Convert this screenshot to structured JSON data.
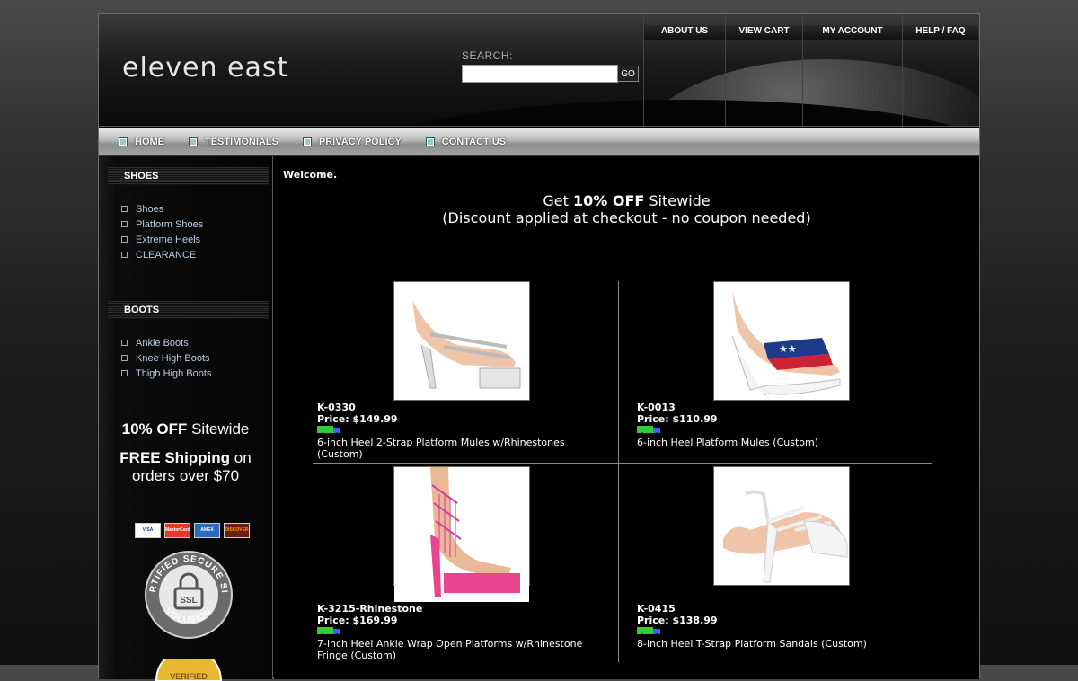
{
  "header": {
    "logo": "eleven east",
    "search_label": "SEARCH:",
    "search_value": "",
    "search_go": "GO",
    "top_nav": [
      "ABOUT US",
      "VIEW CART",
      "MY ACCOUNT",
      "HELP / FAQ"
    ]
  },
  "navbar": [
    "HOME",
    "TESTIMONIALS",
    "PRIVACY POLICY",
    "CONTACT US"
  ],
  "sidebar": {
    "shoes_heading": "SHOES",
    "shoes_items": [
      "Shoes",
      "Platform Shoes",
      "Extreme Heels",
      "CLEARANCE"
    ],
    "boots_heading": "BOOTS",
    "boots_items": [
      "Ankle Boots",
      "Knee High Boots",
      "Thigh High Boots"
    ],
    "promo_discount_bold": "10% OFF",
    "promo_discount_rest": " Sitewide",
    "promo_shipping_bold": "FREE Shipping",
    "promo_shipping_rest": " on orders over $70",
    "cards": [
      "VISA",
      "MasterCard",
      "AMEX",
      "DISCOVER"
    ],
    "ssl_badge": "CERTIFIED SECURE SITE SSL VOLUSION",
    "verified_badge": "VERIFIED"
  },
  "main": {
    "welcome": "Welcome.",
    "discount_pre": "Get ",
    "discount_bold": "10% OFF",
    "discount_post": " Sitewide",
    "discount_line2": "(Discount applied at checkout - no coupon needed)",
    "products": [
      {
        "sku": "K-0330",
        "price": "Price: $149.99",
        "description": "6-inch Heel 2-Strap Platform Mules w/Rhinestones (Custom)"
      },
      {
        "sku": "K-0013",
        "price": "Price: $110.99",
        "description": "6-inch Heel Platform Mules (Custom)"
      },
      {
        "sku": "K-3215-Rhinestone",
        "price": "Price: $169.99",
        "description": "7-inch Heel Ankle Wrap Open Platforms w/Rhinestone Fringe (Custom)"
      },
      {
        "sku": "K-0415",
        "price": "Price: $138.99",
        "description": "8-inch Heel T-Strap Platform Sandals (Custom)"
      }
    ]
  }
}
